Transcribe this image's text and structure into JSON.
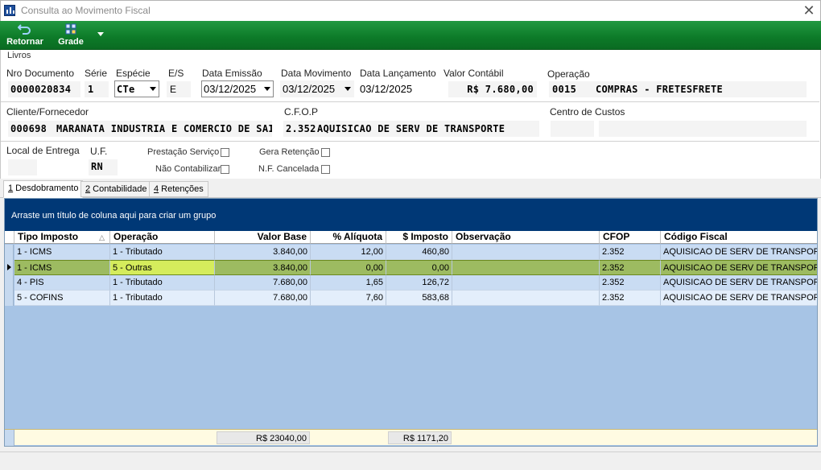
{
  "window": {
    "title": "Consulta ao Movimento Fiscal"
  },
  "toolbar": {
    "back_label": "Retornar",
    "grid_label": "Grade"
  },
  "panel": {
    "legend": "Livros"
  },
  "header": {
    "nro_documento": {
      "label": "Nro Documento",
      "value": "0000020834"
    },
    "serie": {
      "label": "Série",
      "value": "1"
    },
    "especie": {
      "label": "Espécie",
      "value": "CTe"
    },
    "es": {
      "label": "E/S",
      "value": "E"
    },
    "data_emissao": {
      "label": "Data Emissão",
      "value": "03/12/2025"
    },
    "data_movimento": {
      "label": "Data Movimento",
      "value": "03/12/2025"
    },
    "data_lancamento": {
      "label": "Data Lançamento",
      "value": "03/12/2025"
    },
    "valor_contabil": {
      "label": "Valor Contábil",
      "value": "R$ 7.680,00"
    },
    "operacao": {
      "label": "Operação",
      "code": "0015",
      "description": "COMPRAS - FRETESFRETE"
    },
    "cliente": {
      "label": "Cliente/Fornecedor",
      "code": "000698",
      "name": "MARANATA INDUSTRIA E COMERCIO DE SAI"
    },
    "cfop": {
      "label": "C.F.O.P",
      "code": "2.352",
      "description": "AQUISICAO DE SERV DE TRANSPORTE"
    },
    "centro_custos": {
      "label": "Centro de Custos",
      "value": ""
    },
    "local_entrega": {
      "label": "Local de Entrega",
      "value": ""
    },
    "uf": {
      "label": "U.F.",
      "value": "RN"
    },
    "checkboxes": {
      "prestacao_servico": "Prestação Serviço",
      "nao_contabilizar": "Não Contabilizar",
      "gera_retencao": "Gera Retenção",
      "nf_cancelada": "N.F. Cancelada"
    }
  },
  "tabs": [
    {
      "key": "1",
      "label": " Desdobramento"
    },
    {
      "key": "2",
      "label": " Contabilidade"
    },
    {
      "key": "4",
      "label": " Retenções"
    }
  ],
  "grid": {
    "group_hint": "Arraste um título de coluna aqui para criar um grupo",
    "columns": [
      "Tipo Imposto",
      "Operação",
      "Valor Base",
      "% Alíquota",
      "$ Imposto",
      "Observação",
      "CFOP",
      "Código Fiscal"
    ],
    "rows": [
      [
        "1 - ICMS",
        "1 - Tributado",
        "3.840,00",
        "12,00",
        "460,80",
        "",
        "2.352",
        "AQUISICAO DE SERV DE TRANSPORTE"
      ],
      [
        "1 - ICMS",
        "5 - Outras",
        "3.840,00",
        "0,00",
        "0,00",
        "",
        "2.352",
        "AQUISICAO DE SERV DE TRANSPORTE"
      ],
      [
        "4 - PIS",
        "1 - Tributado",
        "7.680,00",
        "1,65",
        "126,72",
        "",
        "2.352",
        "AQUISICAO DE SERV DE TRANSPORTE"
      ],
      [
        "5 - COFINS",
        "1 - Tributado",
        "7.680,00",
        "7,60",
        "583,68",
        "",
        "2.352",
        "AQUISICAO DE SERV DE TRANSPORTE"
      ]
    ],
    "selected_row": 1,
    "totals": {
      "valor_base": "R$ 23040,00",
      "imposto": "R$ 1171,20"
    }
  }
}
